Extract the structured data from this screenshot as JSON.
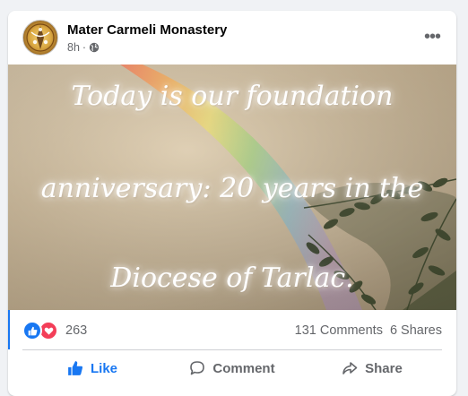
{
  "post": {
    "page_name": "Mater Carmeli Monastery",
    "time": "8h",
    "separator": "·",
    "privacy_icon": "globe-icon",
    "more_label": "•••"
  },
  "media": {
    "lines": [
      "Today is our foundation",
      "anniversary: 20 years in the",
      "Diocese of Tarlac."
    ]
  },
  "stats": {
    "reaction_icons": [
      "like-icon",
      "love-icon"
    ],
    "reaction_count": "263",
    "comments": "131 Comments",
    "shares": "6 Shares"
  },
  "actions": {
    "like": "Like",
    "comment": "Comment",
    "share": "Share"
  },
  "colors": {
    "accent": "#1877f2",
    "love": "#f33e58",
    "muted_text": "#65676b"
  }
}
